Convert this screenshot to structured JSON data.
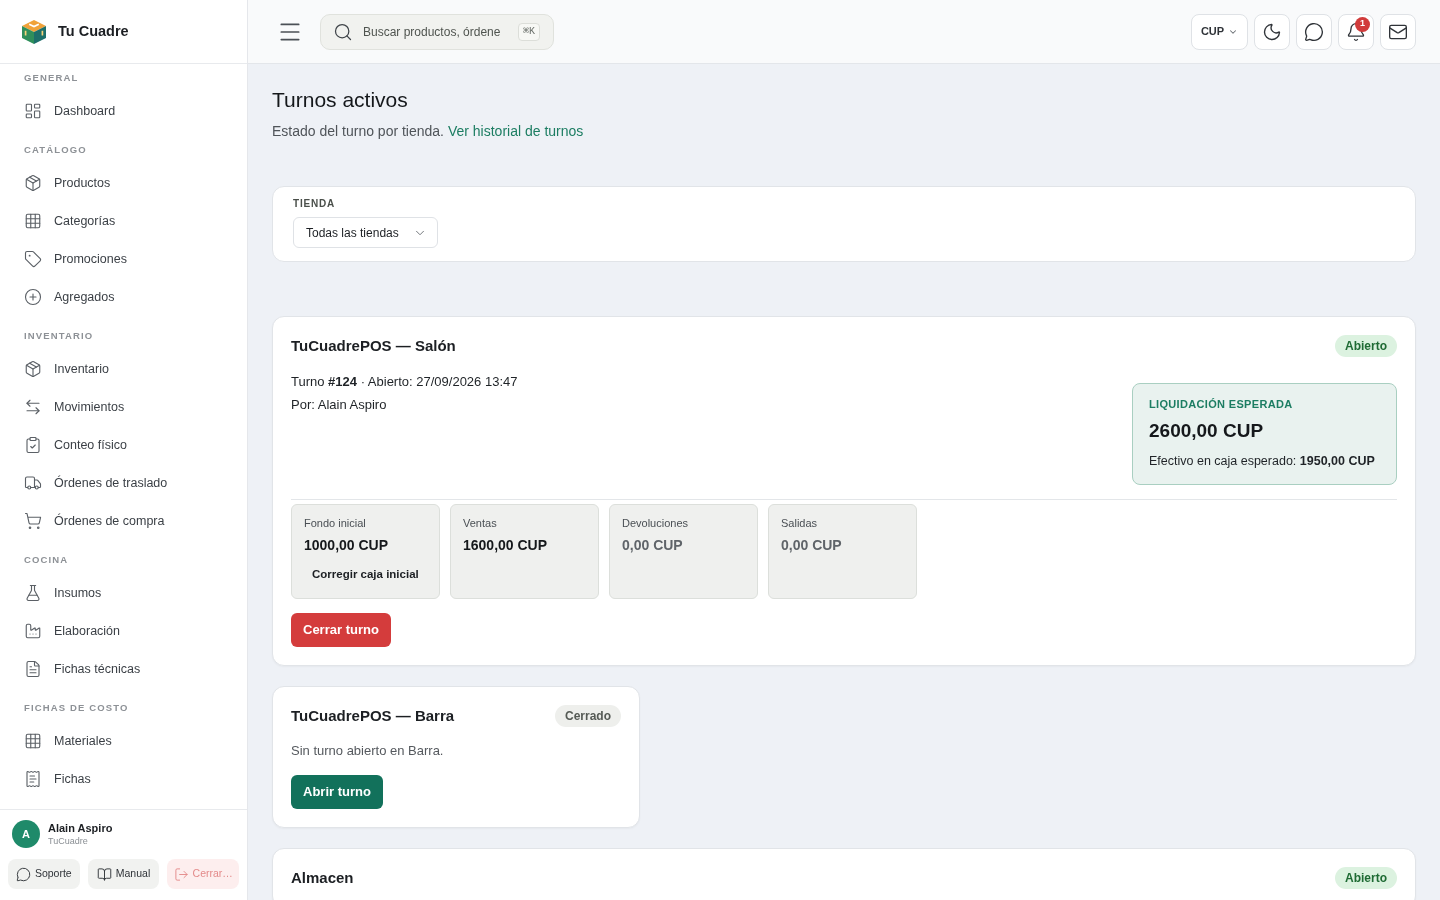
{
  "sidebar": {
    "brand": "Tu Cuadre",
    "sections": [
      {
        "label": "GENERAL",
        "items": [
          {
            "label": "Dashboard",
            "selected": false
          }
        ]
      },
      {
        "label": "CATÁLOGO",
        "items": [
          {
            "label": "Productos",
            "selected": false
          },
          {
            "label": "Categorías",
            "selected": false
          },
          {
            "label": "Promociones",
            "selected": false
          },
          {
            "label": "Agregados",
            "selected": false
          }
        ]
      },
      {
        "label": "INVENTARIO",
        "items": [
          {
            "label": "Inventario",
            "selected": false
          },
          {
            "label": "Movimientos",
            "selected": false
          },
          {
            "label": "Conteo físico",
            "selected": false
          },
          {
            "label": "Órdenes de traslado",
            "selected": false
          },
          {
            "label": "Órdenes de compra",
            "selected": false
          }
        ]
      },
      {
        "label": "COCINA",
        "items": [
          {
            "label": "Insumos",
            "selected": false
          },
          {
            "label": "Elaboración",
            "selected": false
          },
          {
            "label": "Fichas técnicas",
            "selected": false
          }
        ]
      },
      {
        "label": "FICHAS DE COSTO",
        "items": [
          {
            "label": "Materiales",
            "selected": false
          },
          {
            "label": "Fichas",
            "selected": false
          }
        ]
      }
    ],
    "user": {
      "initial": "A",
      "name": "Alain Aspiro",
      "org": "TuCuadre"
    },
    "footer_buttons": [
      {
        "label": "Soporte",
        "kind": "default"
      },
      {
        "label": "Manual",
        "kind": "default"
      },
      {
        "label": "Cerrar…",
        "kind": "danger"
      }
    ]
  },
  "topbar": {
    "search": {
      "placeholder": "Buscar productos, órdene",
      "shortcut": "⌘K"
    },
    "currency": "CUP",
    "notification_count": "1"
  },
  "page": {
    "title": "Turnos activos",
    "subtitle": "Estado del turno por tienda.",
    "history_link": "Ver historial de turnos"
  },
  "filter": {
    "label": "TIENDA",
    "value": "Todas las tiendas"
  },
  "stores": [
    {
      "name": "TuCuadrePOS — Salón",
      "status": {
        "label": "Abierto",
        "kind": "open"
      },
      "shift": {
        "info": "Turno **#124** · Abierto: 27/09/2026 13:47",
        "by": "Por: Alain Aspiro"
      },
      "settlement": {
        "label": "LIQUIDACIÓN ESPERADA",
        "amount": "2600,00 CUP",
        "cash": "Efectivo en caja esperado: **1950,00 CUP**"
      },
      "stats": [
        {
          "label": "Fondo inicial",
          "value": "1000,00 CUP",
          "muted": false,
          "action": "Corregir caja inicial"
        },
        {
          "label": "Ventas",
          "value": "1600,00 CUP",
          "muted": false
        },
        {
          "label": "Devoluciones",
          "value": "0,00 CUP",
          "muted": true
        },
        {
          "label": "Salidas",
          "value": "0,00 CUP",
          "muted": true
        }
      ],
      "action": {
        "label": "Cerrar turno",
        "kind": "danger"
      }
    },
    {
      "name": "TuCuadrePOS — Barra",
      "status": {
        "label": "Cerrado",
        "kind": "closed"
      },
      "note": "Sin turno abierto en Barra.",
      "action": {
        "label": "Abrir turno",
        "kind": "primary"
      }
    },
    {
      "name": "Almacen",
      "status": {
        "label": "Abierto",
        "kind": "open"
      }
    }
  ]
}
